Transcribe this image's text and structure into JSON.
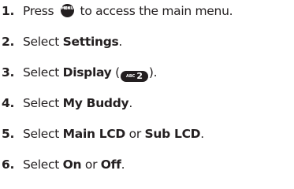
{
  "steps": [
    {
      "num": "1.",
      "t1": "Press ",
      "key_menu_top": "MENU",
      "key_menu_bottom": "OK",
      "t2": " to access the main menu."
    },
    {
      "num": "2.",
      "t1": "Select ",
      "b1": "Settings",
      "t2": "."
    },
    {
      "num": "3.",
      "t1": "Select ",
      "b1": "Display",
      "t2": " (",
      "key_abc_label": "ABC",
      "key_abc_digit": "2",
      "t3": ")."
    },
    {
      "num": "4.",
      "t1": "Select ",
      "b1": "My Buddy",
      "t2": "."
    },
    {
      "num": "5.",
      "t1": "Select ",
      "b1": "Main LCD",
      "t2": " or ",
      "b2": "Sub LCD",
      "t3": "."
    },
    {
      "num": "6.",
      "t1": "Select ",
      "b1": "On",
      "t2": " or ",
      "b2": "Off",
      "t3": "."
    }
  ]
}
